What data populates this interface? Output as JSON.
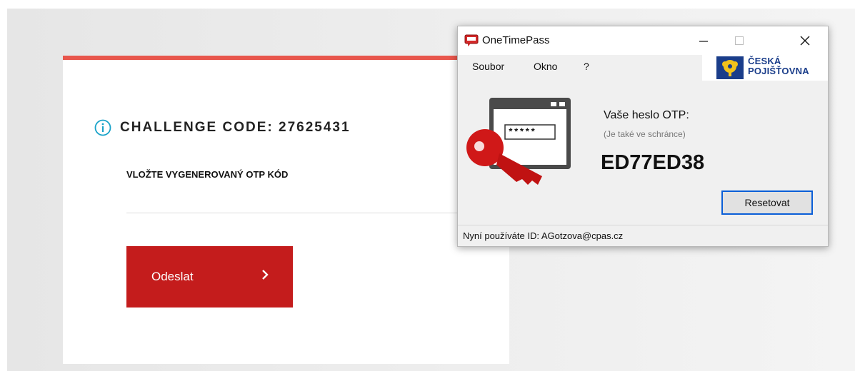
{
  "web_form": {
    "challenge_label": "CHALLENGE CODE: 27625431",
    "otp_instruction": "VLOŽTE VYGENEROVANÝ OTP KÓD",
    "submit_label": "Odeslat",
    "accent_color": "#c41c1c",
    "top_border_color": "#e8564c",
    "info_icon_color": "#1aa3c9"
  },
  "otp_window": {
    "title": "OneTimePass",
    "menu": [
      "Soubor",
      "Okno",
      "?"
    ],
    "logo_text": [
      "ČESKÁ",
      "POJIŠŤOVNA"
    ],
    "password_label": "Vaše heslo OTP:",
    "clipboard_note": "(Je také ve schránce)",
    "password_value": "ED77ED38",
    "reset_label": "Resetovat",
    "masked_field": "*****",
    "status": "Nyní používáte ID: AGotzova@cpas.cz"
  }
}
